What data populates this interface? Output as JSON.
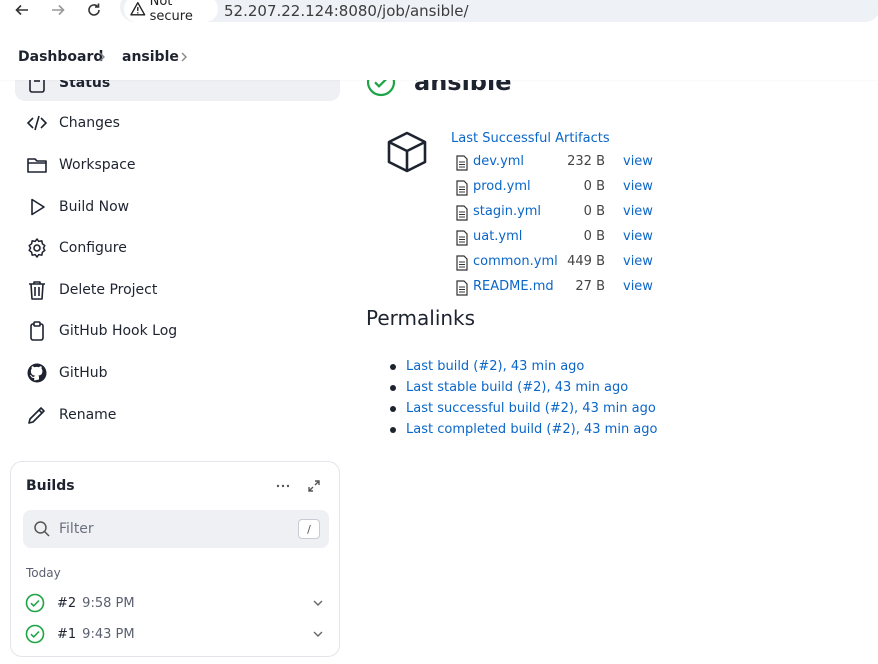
{
  "browser": {
    "security_label": "Not secure",
    "url": "52.207.22.124:8080/job/ansible/"
  },
  "breadcrumb": {
    "items": [
      "Dashboard",
      "ansible"
    ]
  },
  "sidebar": {
    "items": [
      {
        "label": "Status",
        "icon": "status-icon"
      },
      {
        "label": "Changes",
        "icon": "code-icon"
      },
      {
        "label": "Workspace",
        "icon": "folder-icon"
      },
      {
        "label": "Build Now",
        "icon": "play-icon"
      },
      {
        "label": "Configure",
        "icon": "gear-icon"
      },
      {
        "label": "Delete Project",
        "icon": "trash-icon"
      },
      {
        "label": "GitHub Hook Log",
        "icon": "clipboard-icon"
      },
      {
        "label": "GitHub",
        "icon": "github-icon"
      },
      {
        "label": "Rename",
        "icon": "pencil-icon"
      }
    ]
  },
  "builds": {
    "title": "Builds",
    "filter_placeholder": "Filter",
    "filter_shortcut": "/",
    "group_label": "Today",
    "rows": [
      {
        "number": "#2",
        "time": "9:58 PM",
        "status": "success"
      },
      {
        "number": "#1",
        "time": "9:43 PM",
        "status": "success"
      }
    ]
  },
  "job": {
    "title": "ansible",
    "artifacts_title": "Last Successful Artifacts",
    "artifacts": [
      {
        "name": "dev.yml",
        "size": "232 B",
        "action": "view"
      },
      {
        "name": "prod.yml",
        "size": "0 B",
        "action": "view"
      },
      {
        "name": "stagin.yml",
        "size": "0 B",
        "action": "view"
      },
      {
        "name": "uat.yml",
        "size": "0 B",
        "action": "view"
      },
      {
        "name": "common.yml",
        "size": "449 B",
        "action": "view"
      },
      {
        "name": "README.md",
        "size": "27 B",
        "action": "view"
      }
    ],
    "permalinks_title": "Permalinks",
    "permalinks": [
      "Last build (#2), 43 min ago",
      "Last stable build (#2), 43 min ago",
      "Last successful build (#2), 43 min ago",
      "Last completed build (#2), 43 min ago"
    ]
  },
  "colors": {
    "link": "#0b66c8",
    "success": "#1ea446",
    "active_bg": "#eff0f3"
  }
}
